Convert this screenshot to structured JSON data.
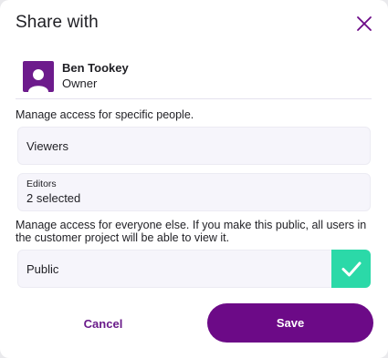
{
  "dialog": {
    "title": "Share with",
    "close_icon": "close-icon"
  },
  "owner": {
    "name": "Ben Tookey",
    "role": "Owner",
    "avatar_icon": "person-icon"
  },
  "specific_people": {
    "heading": "Manage access for specific people.",
    "viewers": {
      "value": "Viewers"
    },
    "editors": {
      "label": "Editors",
      "value": "2 selected"
    }
  },
  "everyone_else": {
    "heading": "Manage access for everyone else. If you make this public, all users in the customer project will be able to view it.",
    "public": {
      "label": "Public",
      "checked": true,
      "check_icon": "checkmark-icon"
    }
  },
  "actions": {
    "cancel_label": "Cancel",
    "save_label": "Save"
  },
  "colors": {
    "primary": "#6c0a87",
    "accent_green": "#2bd9a8",
    "field_bg": "#f6f5fb"
  }
}
